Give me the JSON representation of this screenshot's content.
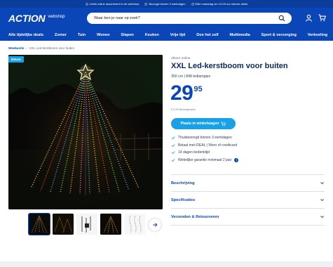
{
  "usp": [
    "Uniek online assortiment in de webshop",
    "Bezorgd binnen 3 werkdagen",
    "Elke maandag om 12.00 uur nieuwe deals"
  ],
  "header": {
    "logo": "ACTION",
    "logo_sub": "webshop",
    "search_placeholder": "Waar ben je naar op zoek?"
  },
  "nav": [
    "Alle tijdelijke deals",
    "Zomer",
    "Tuin",
    "Wonen",
    "Slapen",
    "Keuken",
    "Vrije tijd",
    "Doe het zelf",
    "Multimedia",
    "Sport & verzorging",
    "Verkoeling"
  ],
  "breadcrumb": {
    "parent": "Weekactie",
    "current": "XXL Led-kerstboom voor buiten"
  },
  "badge": "Nieuw",
  "product": {
    "brand": "Alleen online",
    "title": "XXL Led-kerstboom voor buiten",
    "subtitle": "350 cm | 848 ledlampjes",
    "price_int": "29",
    "price_dec": "95",
    "unit_price": "€ 3,99 Bezorgkosten",
    "store_button": "Plaats in winkelwagen"
  },
  "features": [
    "Thuisbezorgd binnen 3 werkdagen",
    "Betaal met iDEAL | Wero of creditcard",
    "14 dagen bedenktijd",
    "Wettelijke garantie minimaal 2 jaar"
  ],
  "accordions": [
    "Beschrijving",
    "Specificaties",
    "Verzenden & Retourneren"
  ],
  "colors": {
    "brand_blue": "#0b46b8",
    "accent_cyan": "#19a0e6",
    "top_bar": "#0a3d9c"
  }
}
